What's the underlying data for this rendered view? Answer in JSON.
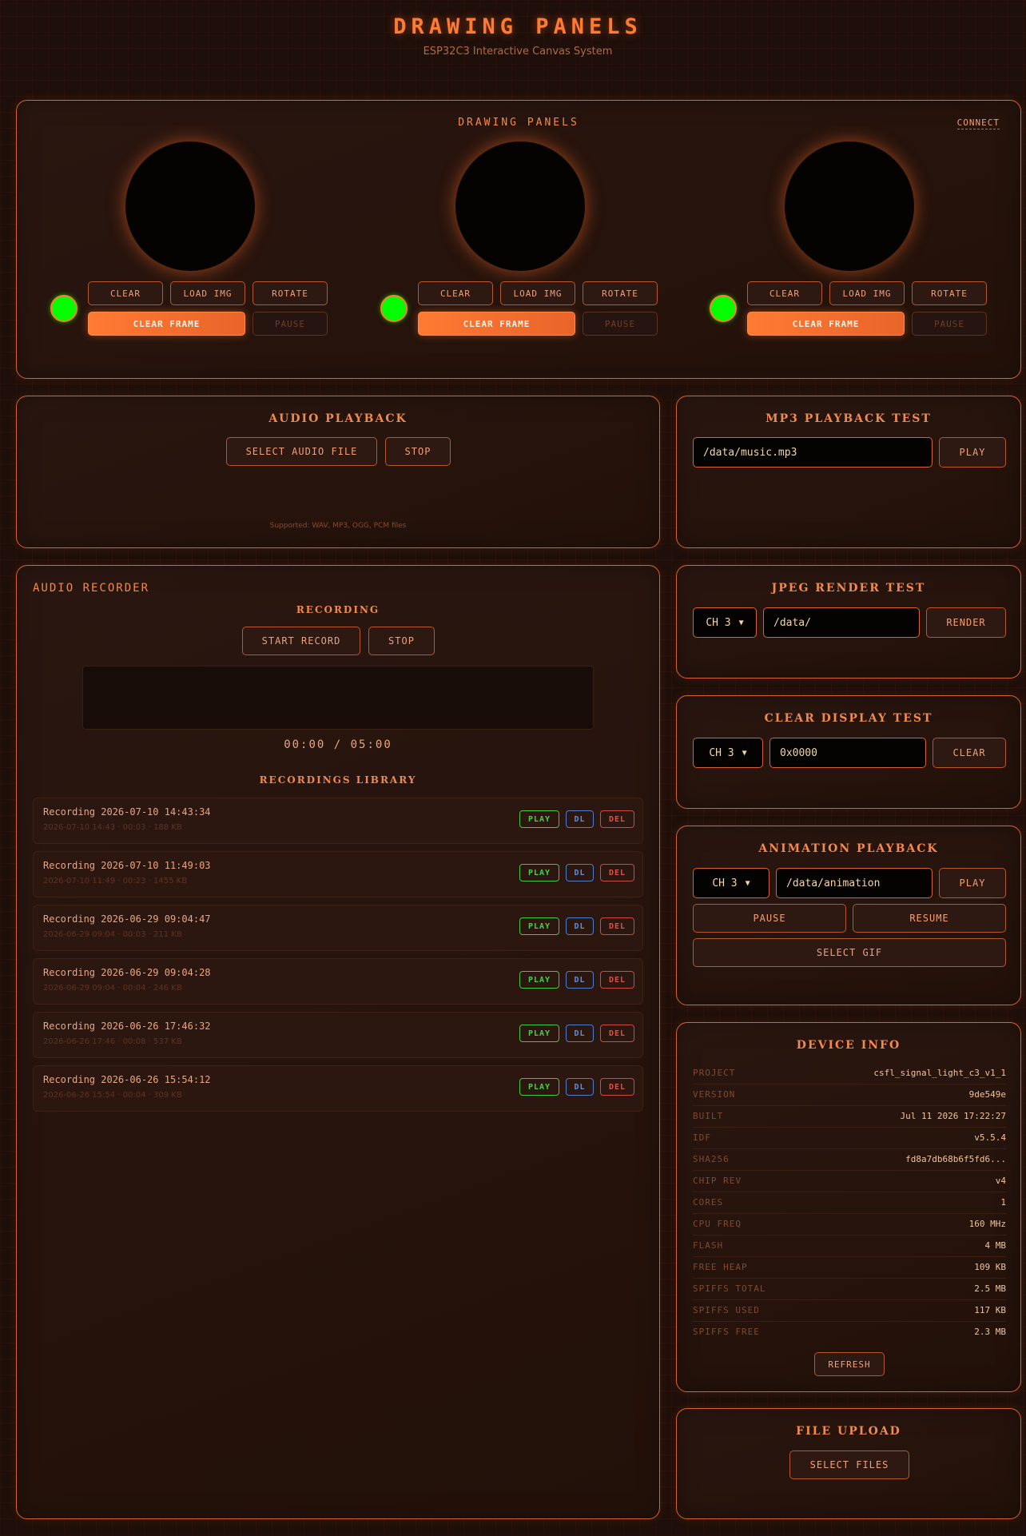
{
  "header": {
    "title": "DRAWING PANELS",
    "subtitle": "ESP32C3 Interactive Canvas System"
  },
  "drawing": {
    "title": "DRAWING PANELS",
    "connect": "CONNECT",
    "panels": [
      {
        "clear": "CLEAR",
        "load": "LOAD IMG",
        "rotate": "ROTATE",
        "clear_frame": "CLEAR FRAME",
        "pause": "PAUSE"
      },
      {
        "clear": "CLEAR",
        "load": "LOAD IMG",
        "rotate": "ROTATE",
        "clear_frame": "CLEAR FRAME",
        "pause": "PAUSE"
      },
      {
        "clear": "CLEAR",
        "load": "LOAD IMG",
        "rotate": "ROTATE",
        "clear_frame": "CLEAR FRAME",
        "pause": "PAUSE"
      }
    ]
  },
  "audio_playback": {
    "title": "AUDIO PLAYBACK",
    "select": "SELECT AUDIO FILE",
    "stop": "STOP",
    "supported": "Supported: WAV, MP3, OGG, PCM files"
  },
  "mp3": {
    "title": "MP3 PLAYBACK TEST",
    "value": "/data/music.mp3",
    "play": "PLAY"
  },
  "recorder": {
    "title": "AUDIO RECORDER",
    "status": "RECORDING",
    "start": "START RECORD",
    "stop": "STOP",
    "time": "00:00 / 05:00",
    "library_title": "RECORDINGS LIBRARY",
    "items": [
      {
        "name": "Recording 2026-07-10 14:43:34",
        "meta": "2026-07-10 14:43 · 00:03 · 188 KB",
        "play": "PLAY",
        "dl": "DL",
        "del": "DEL"
      },
      {
        "name": "Recording 2026-07-10 11:49:03",
        "meta": "2026-07-10 11:49 · 00:23 · 1455 KB",
        "play": "PLAY",
        "dl": "DL",
        "del": "DEL"
      },
      {
        "name": "Recording 2026-06-29 09:04:47",
        "meta": "2026-06-29 09:04 · 00:03 · 211 KB",
        "play": "PLAY",
        "dl": "DL",
        "del": "DEL"
      },
      {
        "name": "Recording 2026-06-29 09:04:28",
        "meta": "2026-06-29 09:04 · 00:04 · 246 KB",
        "play": "PLAY",
        "dl": "DL",
        "del": "DEL"
      },
      {
        "name": "Recording 2026-06-26 17:46:32",
        "meta": "2026-06-26 17:46 · 00:08 · 537 KB",
        "play": "PLAY",
        "dl": "DL",
        "del": "DEL"
      },
      {
        "name": "Recording 2026-06-26 15:54:12",
        "meta": "2026-06-26 15:54 · 00:04 · 309 KB",
        "play": "PLAY",
        "dl": "DL",
        "del": "DEL"
      }
    ]
  },
  "jpeg": {
    "title": "JPEG RENDER TEST",
    "channel": "CH 3",
    "path": "/data/",
    "render": "RENDER"
  },
  "clear_display": {
    "title": "CLEAR DISPLAY TEST",
    "channel": "CH 3",
    "color": "0x0000",
    "clear": "CLEAR"
  },
  "animation": {
    "title": "ANIMATION PLAYBACK",
    "channel": "CH 3",
    "path": "/data/animation",
    "play": "PLAY",
    "pause": "PAUSE",
    "resume": "RESUME",
    "select_gif": "SELECT GIF"
  },
  "device": {
    "title": "DEVICE INFO",
    "rows": [
      {
        "k": "PROJECT",
        "v": "csfl_signal_light_c3_v1_1"
      },
      {
        "k": "VERSION",
        "v": "9de549e"
      },
      {
        "k": "BUILT",
        "v": "Jul 11 2026 17:22:27"
      },
      {
        "k": "IDF",
        "v": "v5.5.4"
      },
      {
        "k": "SHA256",
        "v": "fd8a7db68b6f5fd6..."
      },
      {
        "k": "CHIP REV",
        "v": "v4"
      },
      {
        "k": "CORES",
        "v": "1"
      },
      {
        "k": "CPU FREQ",
        "v": "160 MHz"
      },
      {
        "k": "FLASH",
        "v": "4 MB"
      },
      {
        "k": "FREE HEAP",
        "v": "109 KB"
      },
      {
        "k": "SPIFFS TOTAL",
        "v": "2.5 MB"
      },
      {
        "k": "SPIFFS USED",
        "v": "117 KB"
      },
      {
        "k": "SPIFFS FREE",
        "v": "2.3 MB"
      }
    ],
    "refresh": "REFRESH"
  },
  "upload": {
    "title": "FILE UPLOAD",
    "select": "SELECT FILES"
  },
  "colors": {
    "accent": "#ff7a33",
    "led": "#00ff00",
    "play": "#45d245",
    "dl": "#5b8fe0",
    "del": "#e05048"
  }
}
